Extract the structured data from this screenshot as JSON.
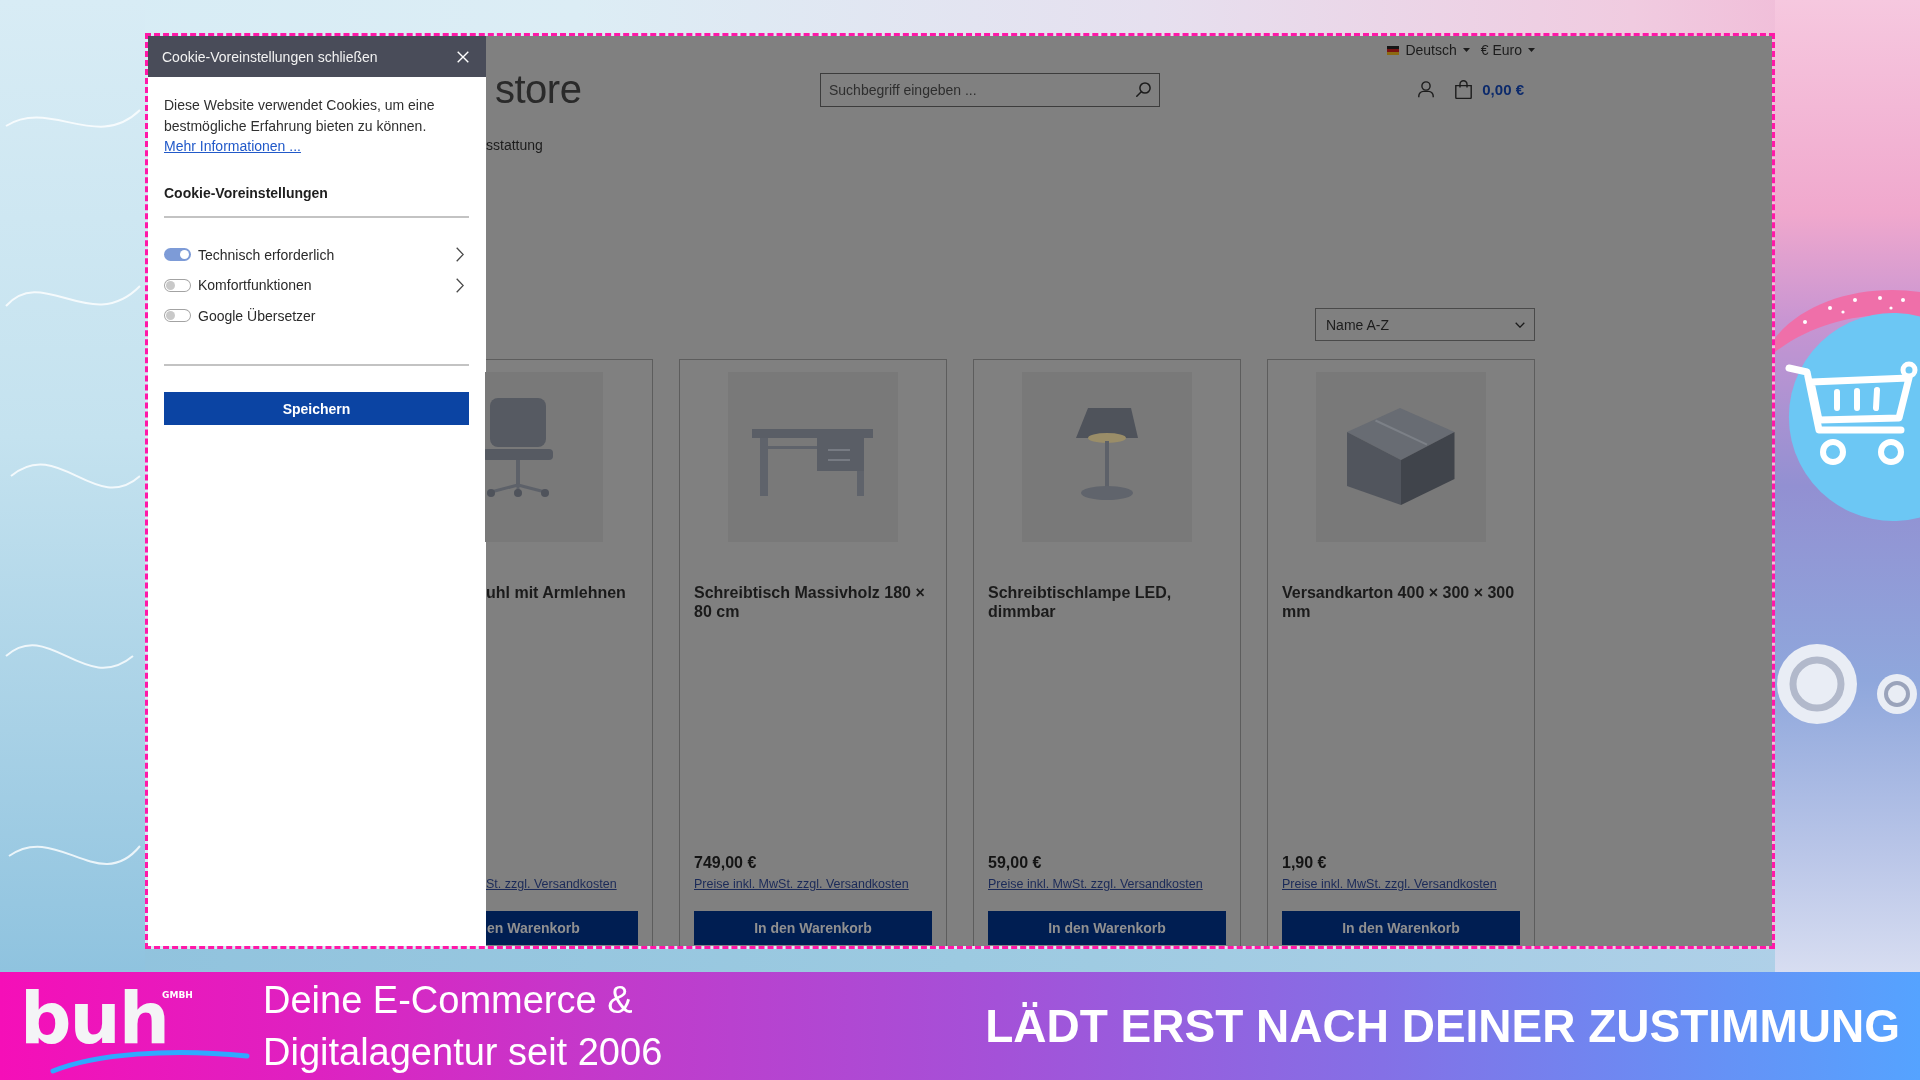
{
  "cookie_panel": {
    "close_label": "Cookie-Voreinstellungen schließen",
    "intro": "Diese Website verwendet Cookies, um eine bestmögliche Erfahrung bieten zu können.",
    "more_link": "Mehr Informationen ...",
    "heading": "Cookie-Voreinstellungen",
    "options": [
      {
        "label": "Technisch erforderlich",
        "on": true,
        "expandable": true
      },
      {
        "label": "Komfortfunktionen",
        "on": false,
        "expandable": true
      },
      {
        "label": "Google Übersetzer",
        "on": false,
        "expandable": false
      }
    ],
    "save_button": "Speichern"
  },
  "store": {
    "language": "Deutsch",
    "currency": "€ Euro",
    "logo": "store",
    "search": {
      "placeholder": "Suchbegriff eingeben ..."
    },
    "cart_total": "0,00 €",
    "nav": [
      "sstattung"
    ],
    "sort": {
      "value": "Name A-Z"
    },
    "products": [
      {
        "kind": "chair",
        "cut_off": true,
        "title": "uhl mit Armlehnen",
        "price_note": "St. zzgl. Versandkosten",
        "button": "en Warenkorb"
      },
      {
        "kind": "desk",
        "cut_off": false,
        "title": "Schreibtisch Massivholz 180 × 80 cm",
        "price": "749,00 €",
        "price_note": "Preise inkl. MwSt. zzgl. Versandkosten",
        "button": "In den Warenkorb"
      },
      {
        "kind": "lamp",
        "cut_off": false,
        "title": "Schreibtischlampe LED, dimmbar",
        "price": "59,00 €",
        "price_note": "Preise inkl. MwSt. zzgl. Versandkosten",
        "button": "In den Warenkorb"
      },
      {
        "kind": "box",
        "cut_off": false,
        "title": "Versandkarton 400 × 300 × 300 mm",
        "price": "1,90 €",
        "price_note": "Preise inkl. MwSt. zzgl. Versandkosten",
        "button": "In den Warenkorb"
      }
    ]
  },
  "banner": {
    "logo": {
      "text": "buh",
      "tag": "GMBH"
    },
    "tagline": "Deine E-Commerce & Digitalagentur seit 2006",
    "headline": "LÄDT ERST NACH DEINER ZUSTIMMUNG"
  }
}
